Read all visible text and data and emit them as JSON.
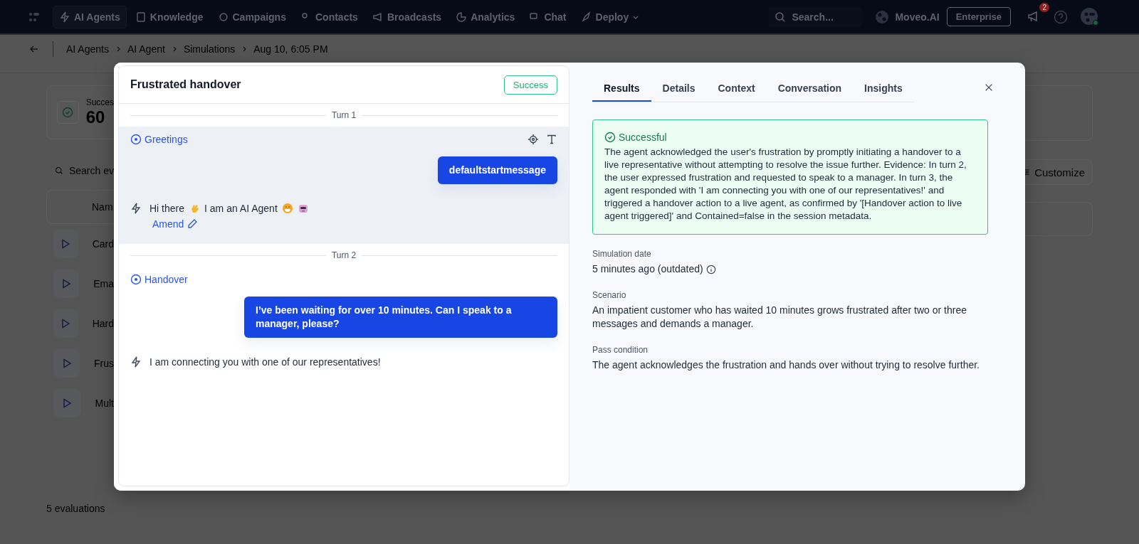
{
  "nav": {
    "items": [
      {
        "label": "AI Agents",
        "selected": true,
        "dropdown": false
      },
      {
        "label": "Knowledge",
        "selected": false,
        "dropdown": false
      },
      {
        "label": "Campaigns",
        "selected": false,
        "dropdown": false
      },
      {
        "label": "Contacts",
        "selected": false,
        "dropdown": false
      },
      {
        "label": "Broadcasts",
        "selected": false,
        "dropdown": false
      },
      {
        "label": "Analytics",
        "selected": false,
        "dropdown": false
      },
      {
        "label": "Chat",
        "selected": false,
        "dropdown": false
      },
      {
        "label": "Deploy",
        "selected": false,
        "dropdown": true
      }
    ],
    "search_placeholder": "Search...",
    "workspace": "Moveo.AI",
    "plan": "Enterprise",
    "notifications": "2"
  },
  "breadcrumb": [
    "AI Agents",
    "AI Agent",
    "Simulations",
    "Aug 10, 6:05 PM"
  ],
  "background": {
    "stat_label": "Succes",
    "stat_value": "60",
    "search_placeholder": "Search ev",
    "column": "Nam",
    "rows": [
      "Card",
      "Ema",
      "Hard",
      "Frus",
      "Mult"
    ],
    "customize": "Customize",
    "footer": "5 evaluations"
  },
  "dialog": {
    "title": "Frustrated handover",
    "status": "Success",
    "turns": [
      {
        "label": "Turn 1",
        "highlighted": true,
        "intent": "Greetings",
        "user_message": "defaultstartmessage",
        "bot_message": [
          {
            "kind": "text",
            "text": "Hi there"
          },
          {
            "kind": "wave"
          },
          {
            "kind": "text",
            "text": "I am an AI Agent"
          },
          {
            "kind": "grin"
          },
          {
            "kind": "robot"
          }
        ],
        "amend": "Amend"
      },
      {
        "label": "Turn 2",
        "highlighted": false,
        "intent": "Handover",
        "user_message": "I’ve been waiting for over 10 minutes. Can I speak to a manager, please?",
        "bot_message": [
          {
            "kind": "text",
            "text": "I am connecting you with one of our representatives!"
          }
        ]
      }
    ],
    "tabs": [
      {
        "label": "Results",
        "selected": true
      },
      {
        "label": "Details",
        "selected": false
      },
      {
        "label": "Context",
        "selected": false
      },
      {
        "label": "Conversation",
        "selected": false
      },
      {
        "label": "Insights",
        "selected": false
      }
    ],
    "result": {
      "title": "Successful",
      "text": "The agent acknowledged the user's frustration by promptly initiating a handover to a live representative without attempting to resolve the issue further. Evidence: In turn 2, the user expressed frustration and requested to speak to a manager. In turn 3, the agent responded with 'I am connecting you with one of our representatives!' and triggered a handover action to a live agent, as confirmed by '[Handover action to live agent triggered]' and Contained=false in the session metadata."
    },
    "fields": [
      {
        "label": "Simulation date",
        "value": "5 minutes ago (outdated)",
        "info": true
      },
      {
        "label": "Scenario",
        "value": "An impatient customer who has waited 10 minutes grows frustrated after two or three messages and demands a manager.",
        "info": false
      },
      {
        "label": "Pass condition",
        "value": "The agent acknowledges the frustration and hands over without trying to resolve further.",
        "info": false
      }
    ]
  }
}
